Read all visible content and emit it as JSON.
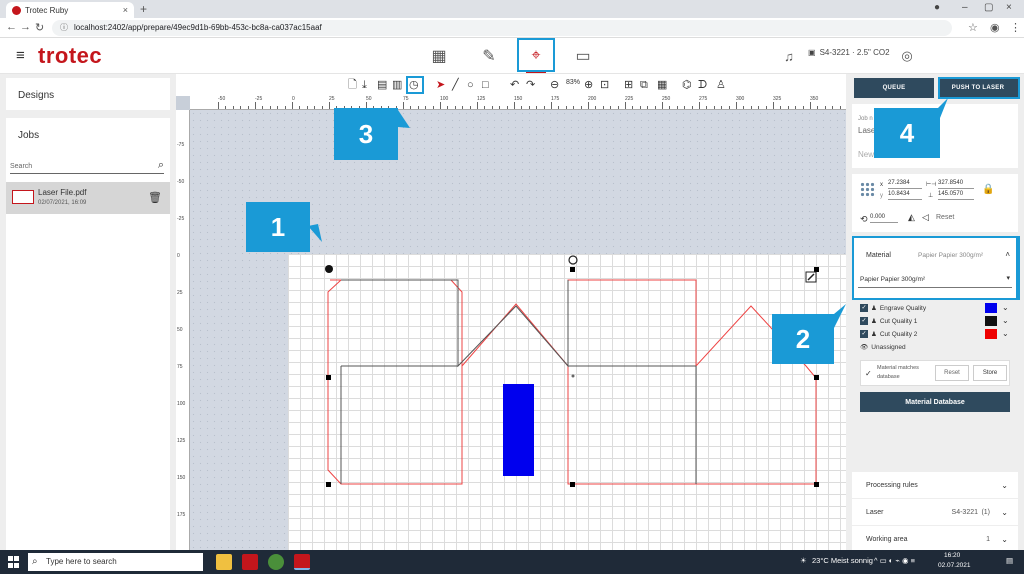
{
  "browser": {
    "tab_title": "Trotec Ruby",
    "url": "localhost:2402/app/prepare/49ec9d1b-69bb-453c-bc8a-ca037ac15aaf"
  },
  "app": {
    "logo": "trotec",
    "device": "S4-3221 · 2.5\" CO2",
    "accent_color": "#c4161c",
    "highlight_color": "#1a9ad6"
  },
  "left_panel": {
    "designs_label": "Designs",
    "jobs_label": "Jobs",
    "search_placeholder": "Search",
    "job": {
      "name": "Laser File.pdf",
      "date": "02/07/2021, 16:09"
    }
  },
  "toolbar": {
    "zoom": "83%"
  },
  "rulers": {
    "top": [
      "-50",
      "-25",
      "0",
      "25",
      "50",
      "75",
      "100",
      "125",
      "150",
      "175",
      "200",
      "225",
      "250",
      "275",
      "300",
      "325",
      "350"
    ],
    "left": [
      "-75",
      "-50",
      "-25",
      "0",
      "25",
      "50",
      "75",
      "100",
      "125",
      "150",
      "175"
    ]
  },
  "callouts": [
    "1",
    "2",
    "3",
    "4"
  ],
  "right_panel": {
    "queue_label": "QUEUE",
    "push_label": "PUSH TO LASER",
    "job_name_label": "Job n",
    "job_name_value": "Laser",
    "job_new": "New",
    "x_label": "x",
    "y_label": "y",
    "x_value": "27.2384",
    "y_value": "10.8434",
    "width_value": "327.8540",
    "height_value": "145.0570",
    "rotation_value": "0.000",
    "reset_label": "Reset",
    "material_label": "Material",
    "material_value": "Papier Papier 300g/m²",
    "material_select": "Papier Papier 300g/m²",
    "qualities": [
      {
        "name": "Engrave Quality",
        "color": "#0000ee"
      },
      {
        "name": "Cut Quality 1",
        "color": "#111111"
      },
      {
        "name": "Cut Quality 2",
        "color": "#ee0000"
      }
    ],
    "unassigned_label": "Unassigned",
    "match_text_line1": "Material matches",
    "match_text_line2": "database",
    "reset_button": "Reset",
    "store_button": "Store",
    "material_db_button": "Material Database",
    "processing_rules": "Processing rules",
    "laser_label": "Laser",
    "laser_value": "S4-3221",
    "laser_count": "(1)",
    "working_area_label": "Working area",
    "working_area_value": "1"
  },
  "taskbar": {
    "search_placeholder": "Type here to search",
    "weather": "23°C  Meist sonnig",
    "time": "16:20",
    "date": "02.07.2021"
  }
}
